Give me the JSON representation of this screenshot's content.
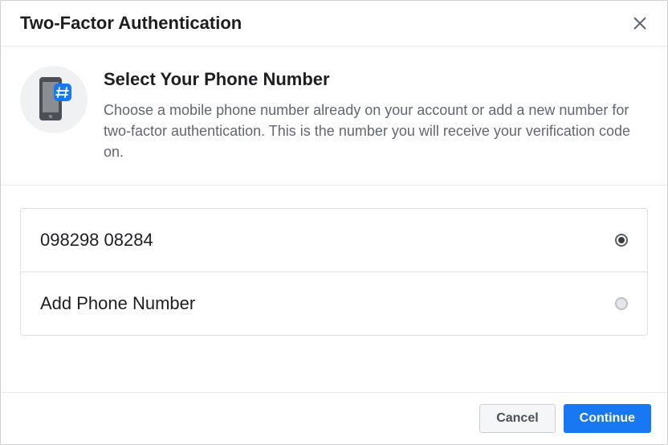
{
  "header": {
    "title": "Two-Factor Authentication"
  },
  "section": {
    "title": "Select Your Phone Number",
    "description": "Choose a mobile phone number already on your account or add a new number for two-factor authentication. This is the number you will receive your verification code on."
  },
  "options": [
    {
      "label": "098298 08284",
      "selected": true
    },
    {
      "label": "Add Phone Number",
      "selected": false
    }
  ],
  "footer": {
    "cancel": "Cancel",
    "continue": "Continue"
  }
}
